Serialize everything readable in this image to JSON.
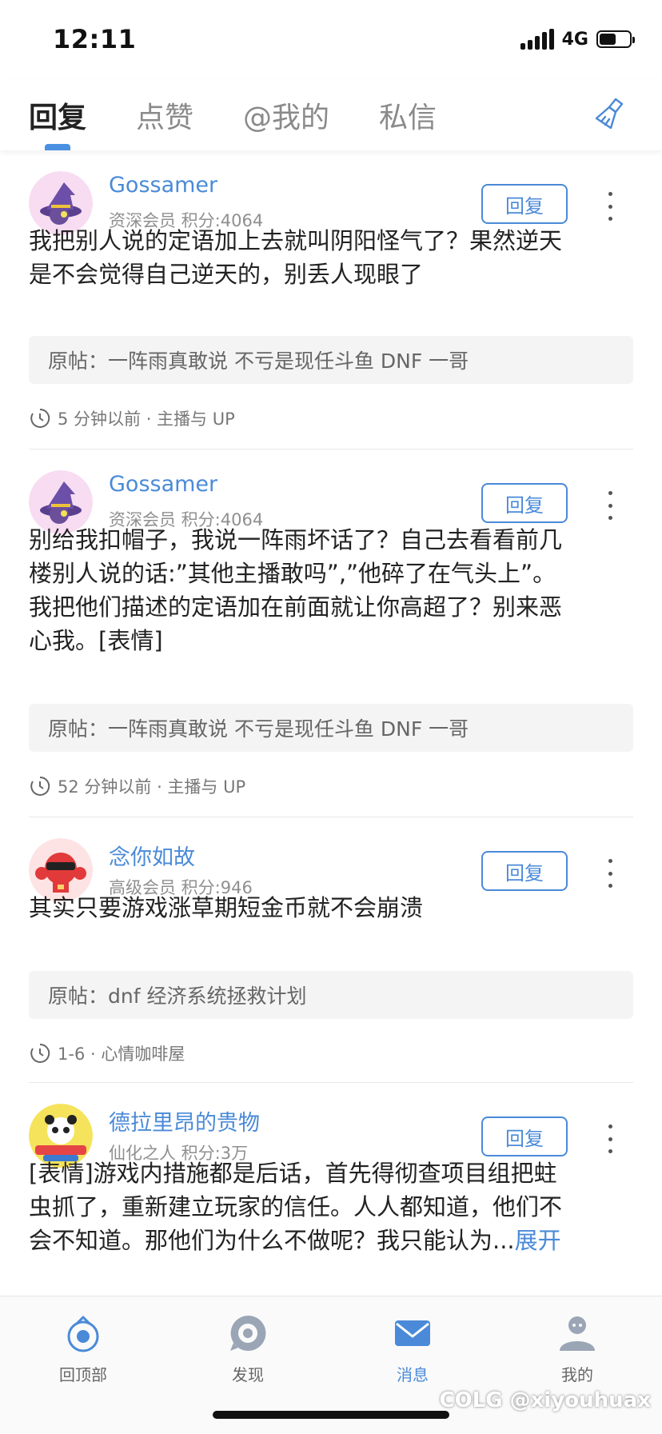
{
  "status": {
    "time": "12:11",
    "network": "4G",
    "battery_level": 0.55
  },
  "tabs": [
    {
      "label": "回复"
    },
    {
      "label": "点赞"
    },
    {
      "label": "@我的"
    },
    {
      "label": "私信"
    }
  ],
  "items": [
    {
      "username": "Gossamer",
      "meta": "资深会员 积分:4064",
      "reply_label": "回复",
      "content_lines": [
        "我把别人说的定语加上去就叫阴阳怪气了？果然逆天",
        "是不会觉得自己逆天的，别丢人现眼了"
      ],
      "quote": "原帖：一阵雨真敢说  不亏是现任斗鱼 DNF 一哥",
      "footer": "5 分钟以前 · 主播与 UP"
    },
    {
      "username": "Gossamer",
      "meta": "资深会员 积分:4064",
      "reply_label": "回复",
      "content_lines": [
        "别给我扣帽子，我说一阵雨坏话了？自己去看看前几",
        "楼别人说的话:”其他主播敢吗”,”他碎了在气头上”。",
        "我把他们描述的定语加在前面就让你高超了？别来恶",
        "心我。[表情]"
      ],
      "quote": "原帖：一阵雨真敢说  不亏是现任斗鱼 DNF 一哥",
      "footer": "52 分钟以前 · 主播与 UP"
    },
    {
      "username": "念你如故",
      "meta": "高级会员 积分:946",
      "reply_label": "回复",
      "content_lines": [
        "其实只要游戏涨草期短金币就不会崩溃"
      ],
      "quote": "原帖：dnf 经济系统拯救计划",
      "footer": "1-6 · 心情咖啡屋"
    },
    {
      "username": "德拉里昂的贵物",
      "meta": "仙化之人 积分:3万",
      "reply_label": "回复",
      "content_lines": [
        "[表情]游戏内措施都是后话，首先得彻查项目组把蛀",
        "虫抓了，重新建立玩家的信任。人人都知道，他们不",
        "会不知道。那他们为什么不做呢？我只能认为..."
      ],
      "expand_label": "展开"
    }
  ],
  "bottom_nav": [
    {
      "label": "回顶部",
      "icon": "back-to-top-icon"
    },
    {
      "label": "发现",
      "icon": "discover-icon"
    },
    {
      "label": "消息",
      "icon": "message-icon"
    },
    {
      "label": "我的",
      "icon": "profile-icon"
    }
  ],
  "watermark": "COLG @xiyouhuax",
  "colors": {
    "accent": "#4a8ad8",
    "tab_indicator": "#4a90e2"
  }
}
